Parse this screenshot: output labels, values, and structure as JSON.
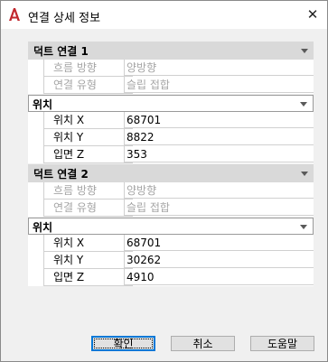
{
  "window": {
    "title": "연결 상세 정보",
    "close_glyph": "✕",
    "accent_color": "#c1272d"
  },
  "sections": [
    {
      "title": "덕트 연결 1",
      "rows": [
        {
          "label": "흐름 방향",
          "value": "양방향"
        },
        {
          "label": "연결 유형",
          "value": "슬립 접합"
        }
      ],
      "location": {
        "title": "위치",
        "rows": [
          {
            "label": "위치 X",
            "value": "68701"
          },
          {
            "label": "위치 Y",
            "value": "8822"
          },
          {
            "label": "입면 Z",
            "value": "353"
          }
        ]
      }
    },
    {
      "title": "덕트 연결 2",
      "rows": [
        {
          "label": "흐름 방향",
          "value": "양방향"
        },
        {
          "label": "연결 유형",
          "value": "슬립 접합"
        }
      ],
      "location": {
        "title": "위치",
        "rows": [
          {
            "label": "위치 X",
            "value": "68701"
          },
          {
            "label": "위치 Y",
            "value": "30262"
          },
          {
            "label": "입면 Z",
            "value": "4910"
          }
        ]
      }
    }
  ],
  "buttons": {
    "ok": "확인",
    "cancel": "취소",
    "help": "도움말"
  }
}
